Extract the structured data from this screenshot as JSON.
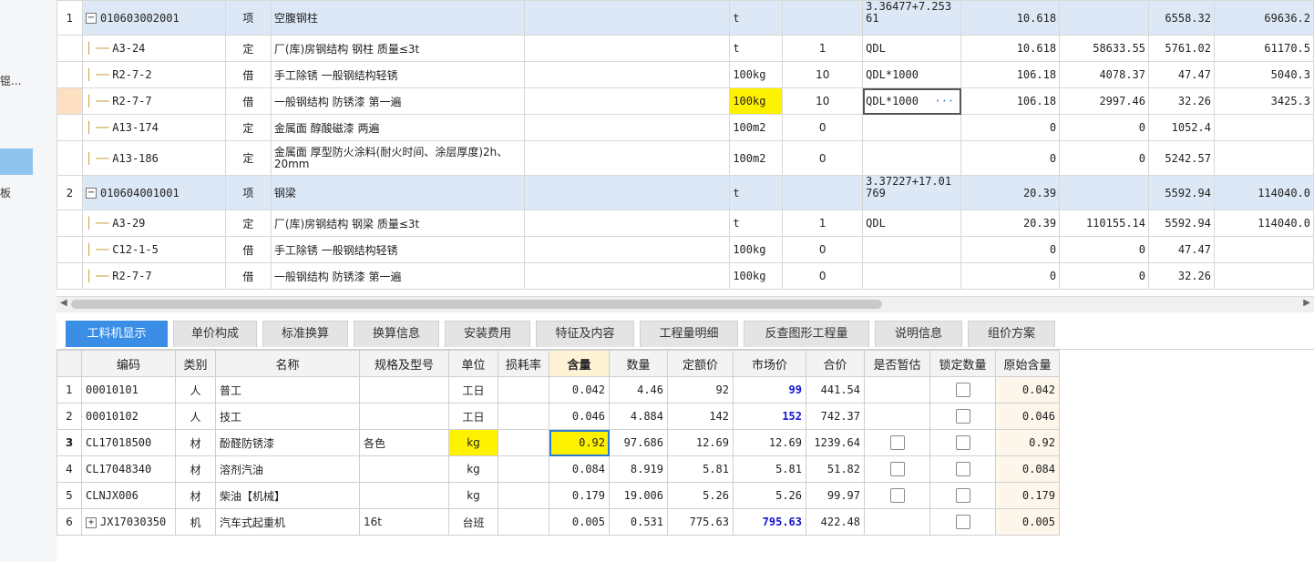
{
  "left_panel": {
    "item1": "锟...",
    "item2": "板"
  },
  "top_rows": [
    {
      "idx": "1",
      "code": "010603002001",
      "kind": "项",
      "name": "空腹钢柱",
      "unit": "t",
      "qty_factor": "",
      "expr": "3.36477+7.253\n61",
      "qty": "10.618",
      "price": "",
      "unitprice": "6558.32",
      "total": "69636.2"
    },
    {
      "idx": "",
      "code": "A3-24",
      "kind": "定",
      "name": "厂(库)房钢结构 钢柱 质量≤3t",
      "unit": "t",
      "qty_factor": "1",
      "expr": "QDL",
      "qty": "10.618",
      "price": "58633.55",
      "unitprice": "5761.02",
      "total": "61170.5"
    },
    {
      "idx": "",
      "code": "R2-7-2",
      "kind": "借",
      "name": "手工除锈 一般钢结构轻锈",
      "unit": "100kg",
      "qty_factor": "10",
      "expr": "QDL*1000",
      "qty": "106.18",
      "price": "4078.37",
      "unitprice": "47.47",
      "total": "5040.3"
    },
    {
      "idx": "",
      "code": "R2-7-7",
      "kind": "借",
      "name": "一般钢结构 防锈漆 第一遍",
      "unit": "100kg",
      "qty_factor": "10",
      "expr": "QDL*1000",
      "expr_more": "···",
      "qty": "106.18",
      "price": "2997.46",
      "unitprice": "32.26",
      "total": "3425.3"
    },
    {
      "idx": "",
      "code": "A13-174",
      "kind": "定",
      "name": "金属面 醇酸磁漆 两遍",
      "unit": "100m2",
      "qty_factor": "0",
      "expr": "",
      "qty": "0",
      "price": "0",
      "unitprice": "1052.4",
      "total": ""
    },
    {
      "idx": "",
      "code": "A13-186",
      "kind": "定",
      "name": "金属面 厚型防火涂料(耐火时间、涂层厚度)2h、20mm",
      "unit": "100m2",
      "qty_factor": "0",
      "expr": "",
      "qty": "0",
      "price": "0",
      "unitprice": "5242.57",
      "total": ""
    },
    {
      "idx": "2",
      "code": "010604001001",
      "kind": "项",
      "name": "钢梁",
      "unit": "t",
      "qty_factor": "",
      "expr": "3.37227+17.01\n769",
      "qty": "20.39",
      "price": "",
      "unitprice": "5592.94",
      "total": "114040.0"
    },
    {
      "idx": "",
      "code": "A3-29",
      "kind": "定",
      "name": "厂(库)房钢结构 钢梁 质量≤3t",
      "unit": "t",
      "qty_factor": "1",
      "expr": "QDL",
      "qty": "20.39",
      "price": "110155.14",
      "unitprice": "5592.94",
      "total": "114040.0"
    },
    {
      "idx": "",
      "code": "C12-1-5",
      "kind": "借",
      "name": "手工除锈 一般钢结构轻锈",
      "unit": "100kg",
      "qty_factor": "0",
      "expr": "",
      "qty": "0",
      "price": "0",
      "unitprice": "47.47",
      "total": ""
    },
    {
      "idx": "",
      "code": "R2-7-7",
      "kind": "借",
      "name": "一般钢结构 防锈漆 第一遍",
      "unit": "100kg",
      "qty_factor": "0",
      "expr": "",
      "qty": "0",
      "price": "0",
      "unitprice": "32.26",
      "total": ""
    }
  ],
  "tabs": [
    "工料机显示",
    "单价构成",
    "标准换算",
    "换算信息",
    "安装费用",
    "特征及内容",
    "工程量明细",
    "反查图形工程量",
    "说明信息",
    "组价方案"
  ],
  "bottom_headers": [
    "编码",
    "类别",
    "名称",
    "规格及型号",
    "单位",
    "损耗率",
    "含量",
    "数量",
    "定额价",
    "市场价",
    "合价",
    "是否暂估",
    "锁定数量",
    "原始含量"
  ],
  "bottom_rows": [
    {
      "idx": "1",
      "code": "00010101",
      "cat": "人",
      "name": "普工",
      "spec": "",
      "unit": "工日",
      "loss": "",
      "content": "0.042",
      "qty": "4.46",
      "base": "92",
      "market": "99",
      "total": "441.54",
      "orig": "0.042"
    },
    {
      "idx": "2",
      "code": "00010102",
      "cat": "人",
      "name": "技工",
      "spec": "",
      "unit": "工日",
      "loss": "",
      "content": "0.046",
      "qty": "4.884",
      "base": "142",
      "market": "152",
      "total": "742.37",
      "orig": "0.046"
    },
    {
      "idx": "3",
      "code": "CL17018500",
      "cat": "材",
      "name": "酚醛防锈漆",
      "spec": "各色",
      "unit": "kg",
      "loss": "",
      "content": "0.92",
      "qty": "97.686",
      "base": "12.69",
      "market": "12.69",
      "total": "1239.64",
      "orig": "0.92"
    },
    {
      "idx": "4",
      "code": "CL17048340",
      "cat": "材",
      "name": "溶剂汽油",
      "spec": "",
      "unit": "kg",
      "loss": "",
      "content": "0.084",
      "qty": "8.919",
      "base": "5.81",
      "market": "5.81",
      "total": "51.82",
      "orig": "0.084"
    },
    {
      "idx": "5",
      "code": "CLNJX006",
      "cat": "材",
      "name": "柴油【机械】",
      "spec": "",
      "unit": "kg",
      "loss": "",
      "content": "0.179",
      "qty": "19.006",
      "base": "5.26",
      "market": "5.26",
      "total": "99.97",
      "orig": "0.179"
    },
    {
      "idx": "6",
      "code": "JX17030350",
      "cat": "机",
      "name": "汽车式起重机",
      "spec": "16t",
      "unit": "台班",
      "loss": "",
      "content": "0.005",
      "qty": "0.531",
      "base": "775.63",
      "market": "795.63",
      "total": "422.48",
      "orig": "0.005"
    }
  ],
  "icons": {
    "expand": "minus-box-icon",
    "collapse": "plus-box-icon",
    "ellipsis": "ellipsis-icon"
  },
  "colors": {
    "highlight": "#fff200",
    "active_tab": "#3a8ee6",
    "market_blue": "#1515d0",
    "item_row": "#dde8f6"
  }
}
